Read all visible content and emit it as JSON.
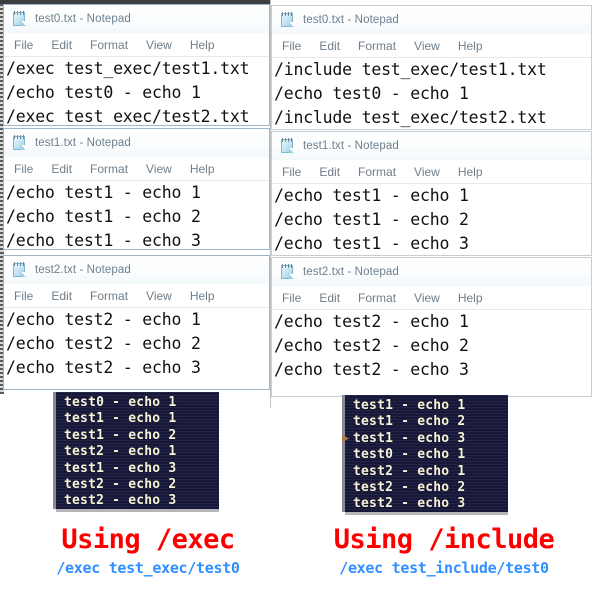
{
  "menu": {
    "items": [
      "File",
      "Edit",
      "Format",
      "View",
      "Help"
    ]
  },
  "windows": {
    "left": [
      {
        "title": "test0.txt - Notepad",
        "lines": [
          "/exec test_exec/test1.txt",
          "/echo test0 - echo 1",
          "/exec test_exec/test2.txt"
        ]
      },
      {
        "title": "test1.txt - Notepad",
        "lines": [
          "/echo test1 - echo 1",
          "/echo test1 - echo 2",
          "/echo test1 - echo 3"
        ]
      },
      {
        "title": "test2.txt - Notepad",
        "lines": [
          "/echo test2 - echo 1",
          "/echo test2 - echo 2",
          "/echo test2 - echo 3"
        ]
      }
    ],
    "right": [
      {
        "title": "test0.txt - Notepad",
        "lines": [
          "/include test_exec/test1.txt",
          "/echo test0 - echo 1",
          "/include test_exec/test2.txt"
        ]
      },
      {
        "title": "test1.txt - Notepad",
        "lines": [
          "/echo test1 - echo 1",
          "/echo test1 - echo 2",
          "/echo test1 - echo 3"
        ]
      },
      {
        "title": "test2.txt - Notepad",
        "lines": [
          "/echo test2 - echo 1",
          "/echo test2 - echo 2",
          "/echo test2 - echo 3"
        ]
      }
    ]
  },
  "consoles": {
    "left": {
      "lines": [
        "test0 - echo 1",
        "test1 - echo 1",
        "test1 - echo 2",
        "test2 - echo 1",
        "test1 - echo 3",
        "test2 - echo 2",
        "test2 - echo 3"
      ]
    },
    "right": {
      "lines": [
        "test1 - echo 1",
        "test1 - echo 2",
        "test1 - echo 3",
        "test0 - echo 1",
        "test2 - echo 1",
        "test2 - echo 2",
        "test2 - echo 3"
      ]
    }
  },
  "captions": {
    "left": {
      "title": "Using /exec",
      "command": "/exec test_exec/test0"
    },
    "right": {
      "title": "Using /include",
      "command": "/exec test_include/test0"
    }
  },
  "colors": {
    "caption_title": "#fc0000",
    "caption_command": "#2f8fff",
    "console_bg": "#17173a",
    "console_text": "#f7f4d8"
  },
  "icons": {
    "notepad": "notepad-icon"
  }
}
